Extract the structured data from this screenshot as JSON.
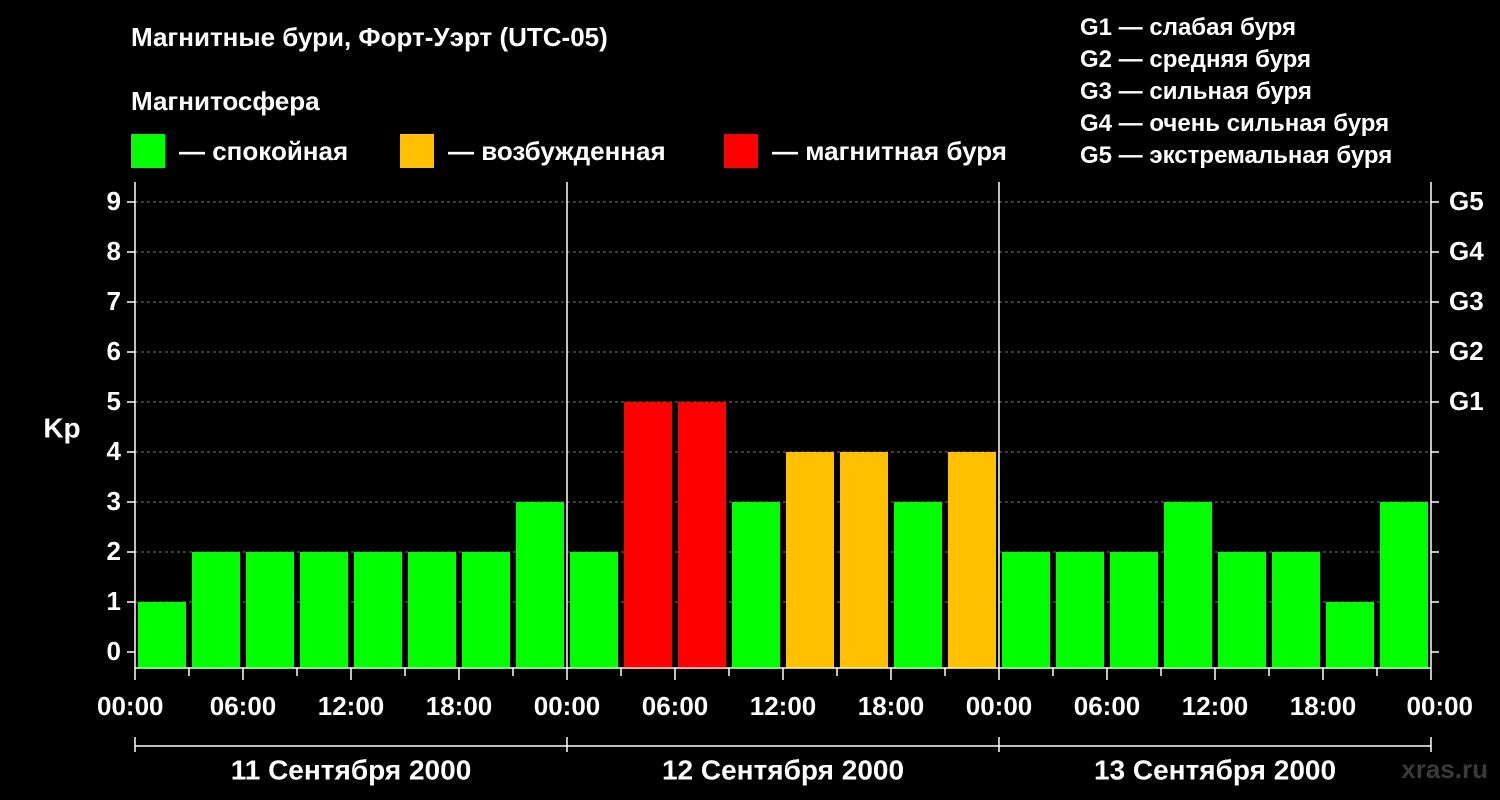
{
  "title": "Магнитные бури, Форт-Уэрт (UTC-05)",
  "magnetosphere": {
    "title": "Магнитосфера",
    "items": [
      {
        "label": "— спокойная",
        "color": "#00ff00"
      },
      {
        "label": "— возбужденная",
        "color": "#ffc000"
      },
      {
        "label": "— магнитная буря",
        "color": "#ff0000"
      }
    ]
  },
  "g_scale": [
    "G1 — слабая буря",
    "G2 — средняя буря",
    "G3 — сильная буря",
    "G4 — очень сильная буря",
    "G5 — экстремальная буря"
  ],
  "watermark": "xras.ru",
  "chart_data": {
    "type": "bar",
    "ylabel": "Kp",
    "ylim": [
      0,
      9
    ],
    "y_ticks": [
      "0",
      "1",
      "2",
      "3",
      "4",
      "5",
      "6",
      "7",
      "8",
      "9"
    ],
    "right_ticks": [
      {
        "value": 5,
        "label": "G1"
      },
      {
        "value": 6,
        "label": "G2"
      },
      {
        "value": 7,
        "label": "G3"
      },
      {
        "value": 8,
        "label": "G4"
      },
      {
        "value": 9,
        "label": "G5"
      }
    ],
    "x_tick_labels": [
      "00:00",
      "06:00",
      "12:00",
      "18:00",
      "00:00",
      "06:00",
      "12:00",
      "18:00",
      "00:00",
      "06:00",
      "12:00",
      "18:00",
      "00:00"
    ],
    "days": [
      "11 Сентября 2000",
      "12 Сентября 2000",
      "13 Сентября 2000"
    ],
    "interval_hours": 3,
    "values": [
      1,
      2,
      2,
      2,
      2,
      2,
      2,
      3,
      2,
      5,
      5,
      3,
      4,
      4,
      3,
      4,
      2,
      2,
      2,
      3,
      2,
      2,
      1,
      3
    ],
    "colors": {
      "quiet": "#00ff00",
      "active": "#ffc000",
      "storm": "#ff0000"
    },
    "grid": "dashed horizontal"
  }
}
